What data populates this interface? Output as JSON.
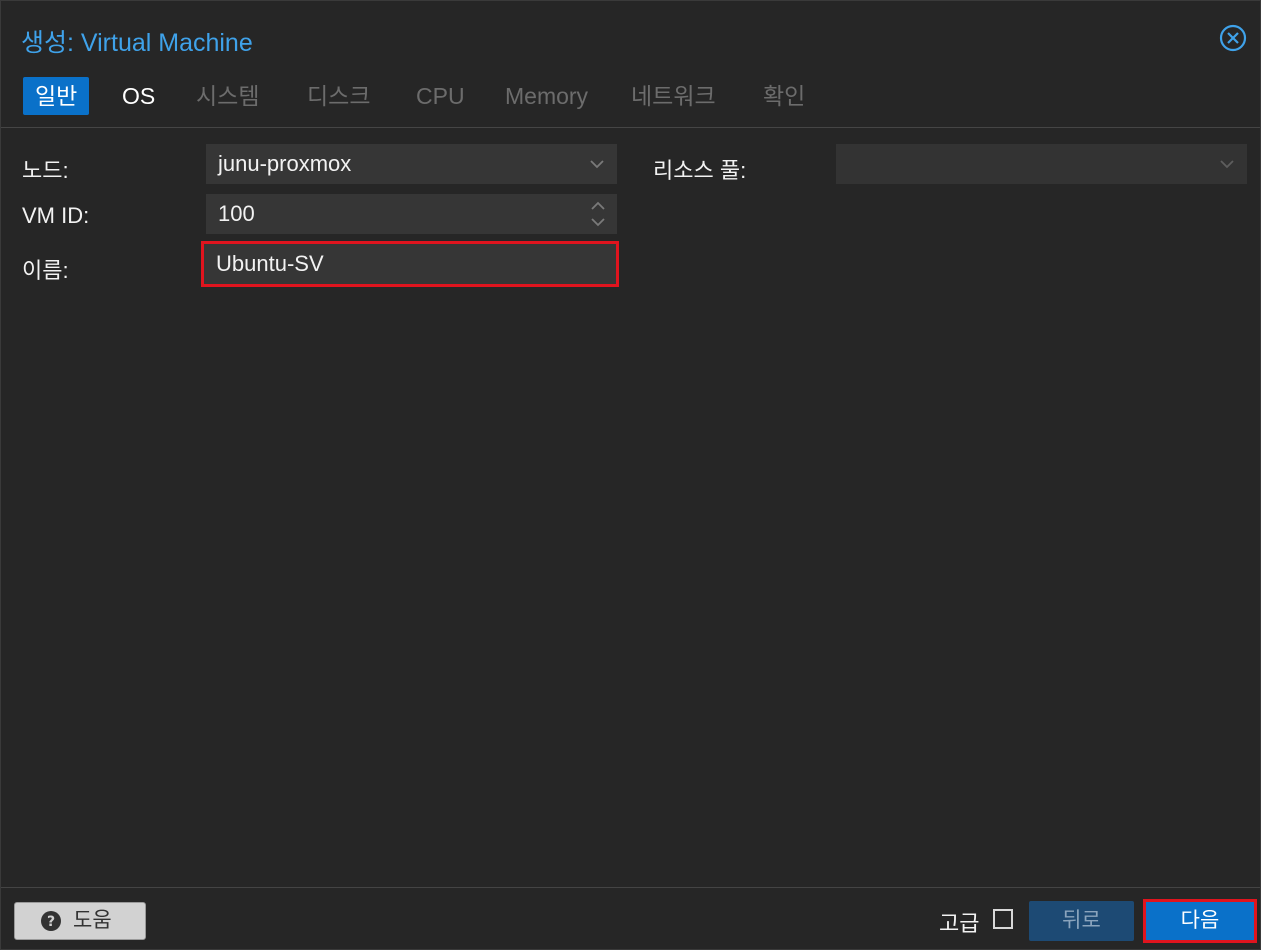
{
  "dialog": {
    "title": "생성: Virtual Machine",
    "close_icon": "close-circle-icon"
  },
  "tabs": [
    {
      "label": "일반",
      "state": "active"
    },
    {
      "label": "OS",
      "state": "enabled"
    },
    {
      "label": "시스템",
      "state": "disabled"
    },
    {
      "label": "디스크",
      "state": "disabled"
    },
    {
      "label": "CPU",
      "state": "disabled"
    },
    {
      "label": "Memory",
      "state": "disabled"
    },
    {
      "label": "네트워크",
      "state": "disabled"
    },
    {
      "label": "확인",
      "state": "disabled"
    }
  ],
  "form": {
    "node_label": "노드:",
    "node_value": "junu-proxmox",
    "vmid_label": "VM ID:",
    "vmid_value": "100",
    "name_label": "이름:",
    "name_value": "Ubuntu-SV",
    "pool_label": "리소스 풀:",
    "pool_value": ""
  },
  "footer": {
    "help_label": "도움",
    "advanced_label": "고급",
    "advanced_checked": false,
    "back_label": "뒤로",
    "next_label": "다음"
  },
  "colors": {
    "accent": "#0a71c9",
    "title": "#3fa2ea",
    "highlight": "#e0141e"
  }
}
